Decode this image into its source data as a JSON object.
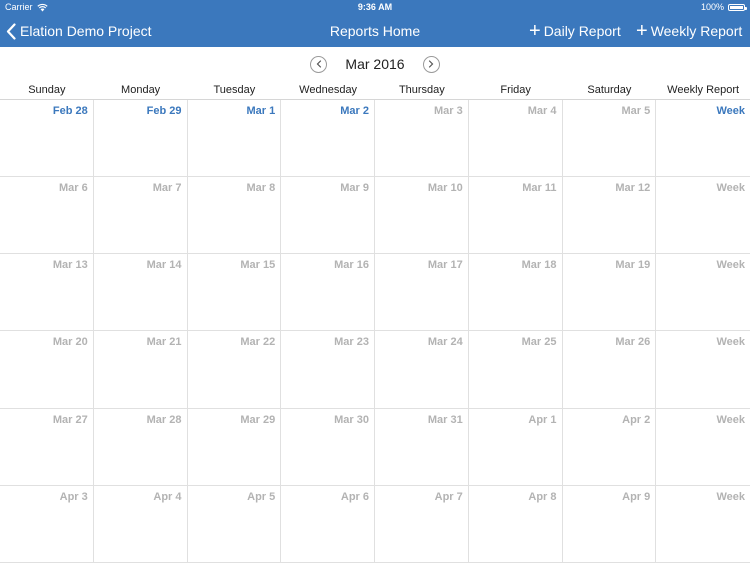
{
  "status_bar": {
    "carrier": "Carrier",
    "time": "9:36 AM",
    "battery": "100%"
  },
  "nav": {
    "back_label": "Elation Demo Project",
    "title": "Reports Home",
    "daily_label": "Daily Report",
    "weekly_label": "Weekly Report",
    "accent_color": "#3b78bd"
  },
  "calendar": {
    "month": "Mar 2016",
    "headers": [
      "Sunday",
      "Monday",
      "Tuesday",
      "Wednesday",
      "Thursday",
      "Friday",
      "Saturday",
      "Weekly Report"
    ],
    "rows": [
      {
        "cells": [
          "Feb 28",
          "Feb 29",
          "Mar 1",
          "Mar 2",
          "Mar 3",
          "Mar 4",
          "Mar 5",
          "Week"
        ],
        "highlight": [
          true,
          true,
          true,
          true,
          false,
          false,
          false,
          true
        ]
      },
      {
        "cells": [
          "Mar 6",
          "Mar 7",
          "Mar 8",
          "Mar 9",
          "Mar 10",
          "Mar 11",
          "Mar 12",
          "Week"
        ],
        "highlight": [
          false,
          false,
          false,
          false,
          false,
          false,
          false,
          false
        ]
      },
      {
        "cells": [
          "Mar 13",
          "Mar 14",
          "Mar 15",
          "Mar 16",
          "Mar 17",
          "Mar 18",
          "Mar 19",
          "Week"
        ],
        "highlight": [
          false,
          false,
          false,
          false,
          false,
          false,
          false,
          false
        ]
      },
      {
        "cells": [
          "Mar 20",
          "Mar 21",
          "Mar 22",
          "Mar 23",
          "Mar 24",
          "Mar 25",
          "Mar 26",
          "Week"
        ],
        "highlight": [
          false,
          false,
          false,
          false,
          false,
          false,
          false,
          false
        ]
      },
      {
        "cells": [
          "Mar 27",
          "Mar 28",
          "Mar 29",
          "Mar 30",
          "Mar 31",
          "Apr 1",
          "Apr 2",
          "Week"
        ],
        "highlight": [
          false,
          false,
          false,
          false,
          false,
          false,
          false,
          false
        ]
      },
      {
        "cells": [
          "Apr 3",
          "Apr 4",
          "Apr 5",
          "Apr 6",
          "Apr 7",
          "Apr 8",
          "Apr 9",
          "Week"
        ],
        "highlight": [
          false,
          false,
          false,
          false,
          false,
          false,
          false,
          false
        ]
      }
    ]
  }
}
